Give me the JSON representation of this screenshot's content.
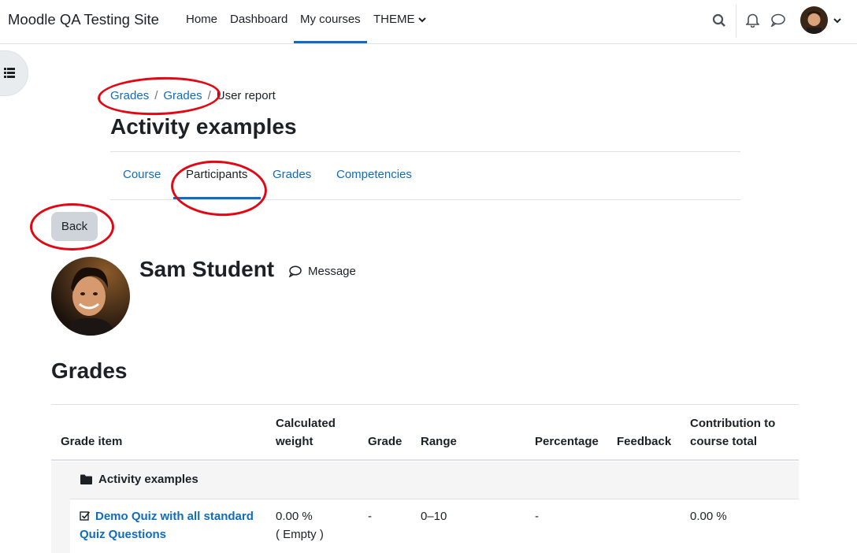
{
  "navbar": {
    "site_name": "Moodle QA Testing Site",
    "links": [
      "Home",
      "Dashboard",
      "My courses",
      "THEME"
    ],
    "active_link": "My courses",
    "accent_color": "#0f6cbf"
  },
  "breadcrumb": {
    "items": [
      "Grades",
      "Grades"
    ],
    "current": "User report",
    "separator": "/"
  },
  "page_title": "Activity examples",
  "secondary_nav": {
    "items": [
      "Course",
      "Participants",
      "Grades",
      "Competencies"
    ],
    "active": "Participants"
  },
  "back_button": "Back",
  "user": {
    "name": "Sam Student",
    "message_label": "Message"
  },
  "grades_heading": "Grades",
  "table": {
    "headers": {
      "grade_item": "Grade item",
      "weight_line1": "Calculated",
      "weight_line2": "weight",
      "grade": "Grade",
      "range": "Range",
      "percentage": "Percentage",
      "feedback": "Feedback",
      "contribution_line1": "Contribution to",
      "contribution_line2": "course total"
    },
    "category": "Activity examples",
    "rows": [
      {
        "item_line1": "Demo Quiz with all standard",
        "item_line2": "Quiz Questions",
        "weight": "0.00 %",
        "weight_note": "( Empty )",
        "grade": "-",
        "range": "0–10",
        "percentage": "-",
        "feedback": "",
        "contribution": "0.00 %"
      }
    ]
  },
  "annotation_color": "#e30613"
}
